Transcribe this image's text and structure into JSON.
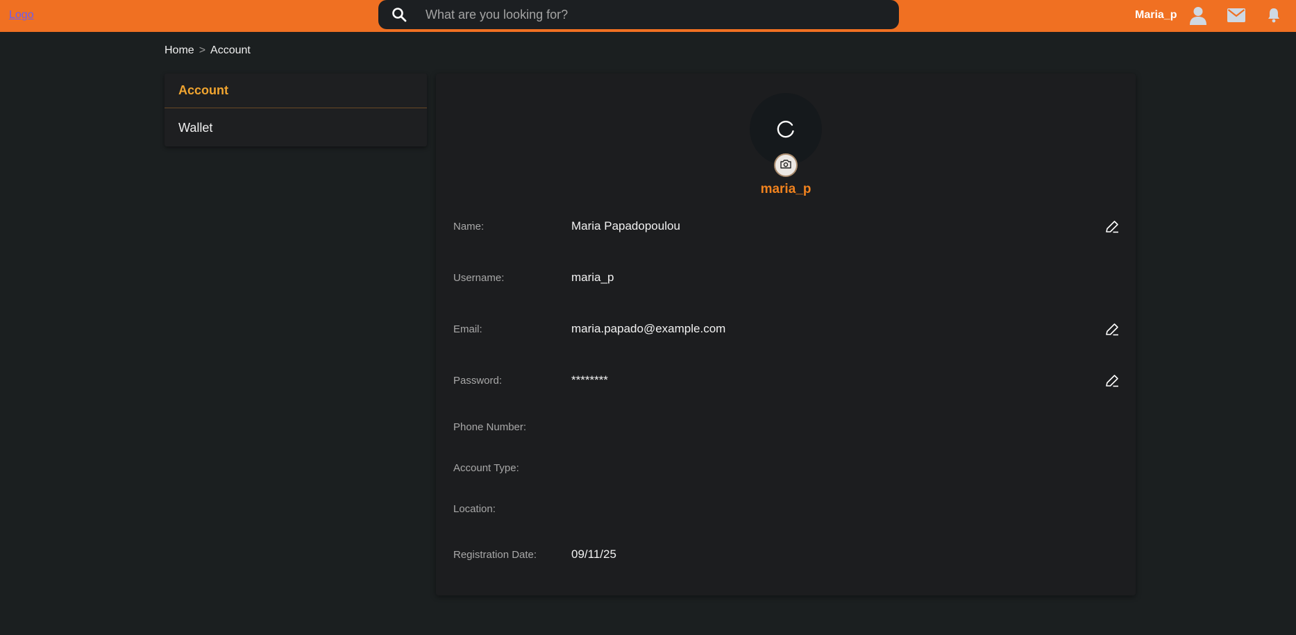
{
  "header": {
    "logo": "Logo",
    "search_placeholder": "What are you looking for?",
    "username": "Maria_p"
  },
  "breadcrumb": {
    "home": "Home",
    "separator": ">",
    "current": "Account"
  },
  "sidebar": {
    "items": [
      {
        "label": "Account",
        "active": true
      },
      {
        "label": "Wallet",
        "active": false
      }
    ]
  },
  "profile": {
    "username_display": "maria_p",
    "fields": {
      "name": {
        "label": "Name:",
        "value": "Maria Papadopoulou"
      },
      "username": {
        "label": "Username:",
        "value": "maria_p"
      },
      "email": {
        "label": "Email:",
        "value": "maria.papado@example.com"
      },
      "password": {
        "label": "Password:",
        "value": "********"
      },
      "phone": {
        "label": "Phone Number:",
        "value": ""
      },
      "account_type": {
        "label": "Account Type:",
        "value": ""
      },
      "location": {
        "label": "Location:",
        "value": ""
      },
      "registration_date": {
        "label": "Registration Date:",
        "value": "09/11/25"
      }
    }
  },
  "colors": {
    "accent": "#f07022",
    "active_item": "#f1a530",
    "username_orange": "#f0821e",
    "background": "#1b1f20"
  },
  "icons": [
    "search-icon",
    "user-icon",
    "mail-icon",
    "bell-icon",
    "loading-spinner-icon",
    "camera-icon",
    "pencil-icon"
  ]
}
